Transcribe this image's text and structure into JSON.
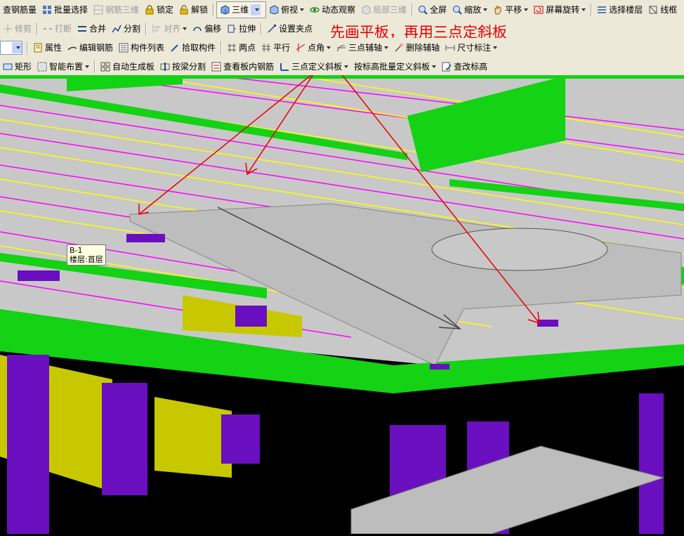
{
  "toolbar1": {
    "steel_amount": "查钢筋量",
    "batch_select": "批量选择",
    "steel_3d": "钢筋三维",
    "lock": "锁定",
    "unlock": "解锁",
    "view_3d": "三维",
    "top_view": "俯视",
    "dynamic_observe": "动态观察",
    "partial_3d": "局部三维",
    "fullscreen": "全屏",
    "zoom": "缩放",
    "pan": "平移",
    "screen_rotate": "屏幕旋转",
    "select_floor": "选择楼层",
    "wire_frame": "线框"
  },
  "toolbar2": {
    "trim": "修剪",
    "break": "打断",
    "merge": "合并",
    "split": "分割",
    "align": "对齐",
    "offset": "偏移",
    "stretch": "拉伸",
    "set_grip": "设置夹点"
  },
  "annotation": {
    "note": "先画平板，再用三点定斜板",
    "color": "#e60000"
  },
  "toolbar3": {
    "properties": "属性",
    "edit_steel": "编辑钢筋",
    "component_list": "构件列表",
    "pick_component": "拾取构件",
    "two_points": "两点",
    "parallel": "平行",
    "point_angle": "点角",
    "three_point_axis": "三点辅轴",
    "delete_axis": "删除辅轴",
    "dimension": "尺寸标注"
  },
  "toolbar4": {
    "rectangle": "矩形",
    "smart_layout": "智能布置",
    "auto_slab": "自动生成板",
    "split_by_beam": "按梁分割",
    "view_slab_steel": "查看板内钢筋",
    "three_point_slope": "三点定义斜板",
    "batch_slope": "按标高批量定义斜板",
    "check_elev": "查改标高"
  },
  "tooltip": {
    "name": "B-1",
    "floor": "楼层:首层"
  },
  "colors": {
    "beam": "#14d214",
    "column": "#6a0fbf",
    "slab": "#c9c9c9",
    "wall": "#c8c800",
    "rebar_x": "#ffff00",
    "rebar_y": "#ff00ff",
    "background": "#000000"
  }
}
